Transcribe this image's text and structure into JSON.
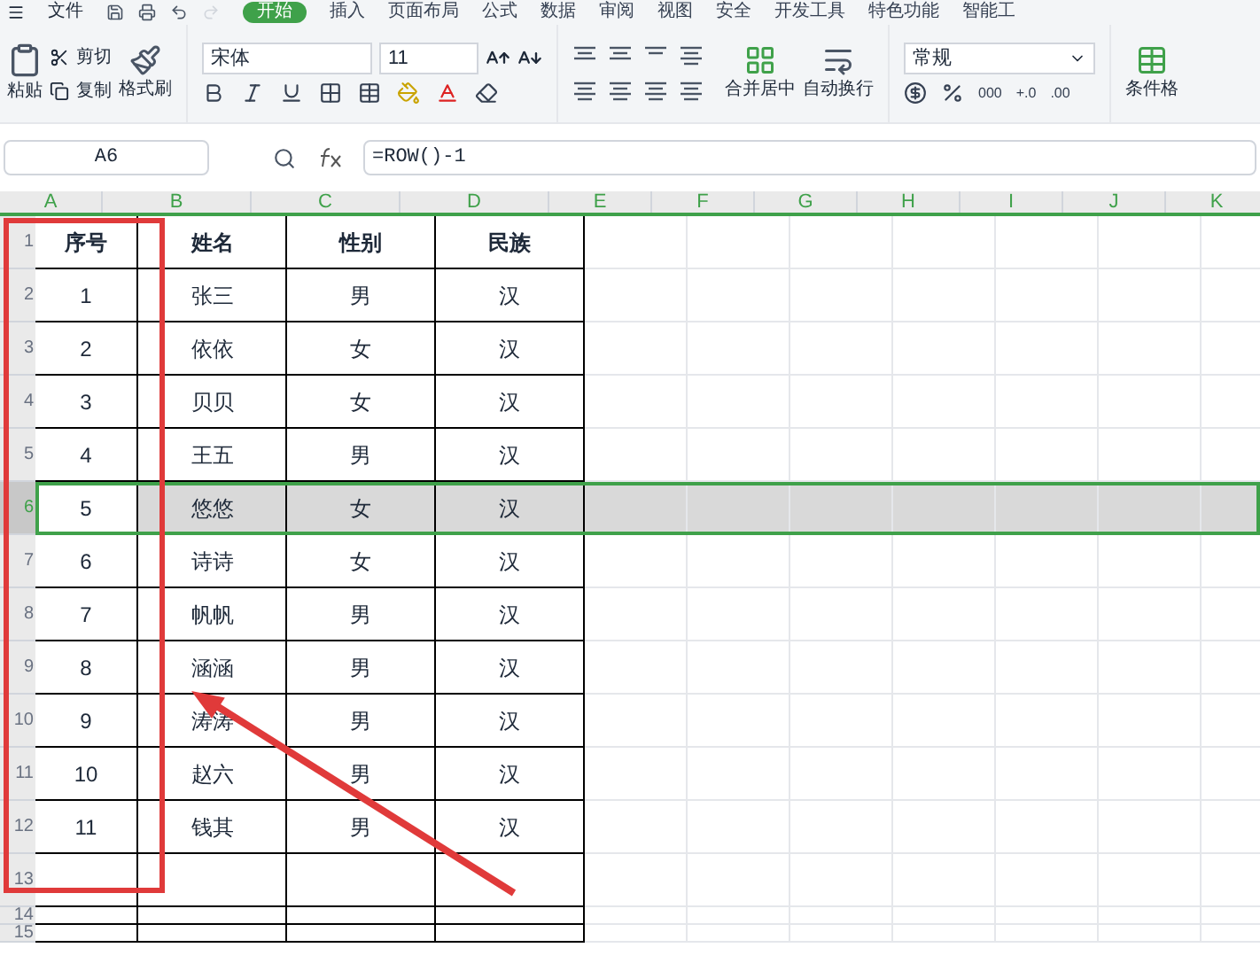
{
  "menu": {
    "file": "文件",
    "tabs": [
      {
        "label": "开始",
        "selected": true
      },
      {
        "label": "插入",
        "selected": false
      },
      {
        "label": "页面布局",
        "selected": false
      },
      {
        "label": "公式",
        "selected": false
      },
      {
        "label": "数据",
        "selected": false
      },
      {
        "label": "审阅",
        "selected": false
      },
      {
        "label": "视图",
        "selected": false
      },
      {
        "label": "安全",
        "selected": false
      },
      {
        "label": "开发工具",
        "selected": false
      },
      {
        "label": "特色功能",
        "selected": false
      },
      {
        "label": "智能工",
        "selected": false
      }
    ]
  },
  "ribbon": {
    "paste": "粘贴",
    "cut": "剪切",
    "copy": "复制",
    "format_painter": "格式刷",
    "font_name": "宋体",
    "font_size": "11",
    "merge": "合并居中",
    "wrap": "自动换行",
    "number_format": "常规",
    "number_buttons": [
      "000",
      "+.0",
      ".00"
    ],
    "conditional": "条件格"
  },
  "formula_bar": {
    "name_box": "A6",
    "formula": "=ROW()-1"
  },
  "columns": [
    "A",
    "B",
    "C",
    "D",
    "E",
    "F",
    "G",
    "H",
    "I",
    "J",
    "K"
  ],
  "rows": [
    {
      "number": "1",
      "kind": "header",
      "selected": false,
      "cells": [
        "序号",
        "姓名",
        "性别",
        "民族"
      ]
    },
    {
      "number": "2",
      "kind": "data",
      "selected": false,
      "cells": [
        "1",
        "张三",
        "男",
        "汉"
      ]
    },
    {
      "number": "3",
      "kind": "data",
      "selected": false,
      "cells": [
        "2",
        "依依",
        "女",
        "汉"
      ]
    },
    {
      "number": "4",
      "kind": "data",
      "selected": false,
      "cells": [
        "3",
        "贝贝",
        "女",
        "汉"
      ]
    },
    {
      "number": "5",
      "kind": "data",
      "selected": false,
      "cells": [
        "4",
        "王五",
        "男",
        "汉"
      ]
    },
    {
      "number": "6",
      "kind": "data",
      "selected": true,
      "cells": [
        "5",
        "悠悠",
        "女",
        "汉"
      ]
    },
    {
      "number": "7",
      "kind": "data",
      "selected": false,
      "cells": [
        "6",
        "诗诗",
        "女",
        "汉"
      ]
    },
    {
      "number": "8",
      "kind": "data",
      "selected": false,
      "cells": [
        "7",
        "帆帆",
        "男",
        "汉"
      ]
    },
    {
      "number": "9",
      "kind": "data",
      "selected": false,
      "cells": [
        "8",
        "涵涵",
        "男",
        "汉"
      ]
    },
    {
      "number": "10",
      "kind": "data",
      "selected": false,
      "cells": [
        "9",
        "涛涛",
        "男",
        "汉"
      ]
    },
    {
      "number": "11",
      "kind": "data",
      "selected": false,
      "cells": [
        "10",
        "赵六",
        "男",
        "汉"
      ]
    },
    {
      "number": "12",
      "kind": "data",
      "selected": false,
      "cells": [
        "11",
        "钱其",
        "男",
        "汉"
      ]
    },
    {
      "number": "13",
      "kind": "data",
      "selected": false
    },
    {
      "number": "14",
      "kind": "thin",
      "selected": false
    },
    {
      "number": "15",
      "kind": "thin",
      "selected": false
    }
  ]
}
